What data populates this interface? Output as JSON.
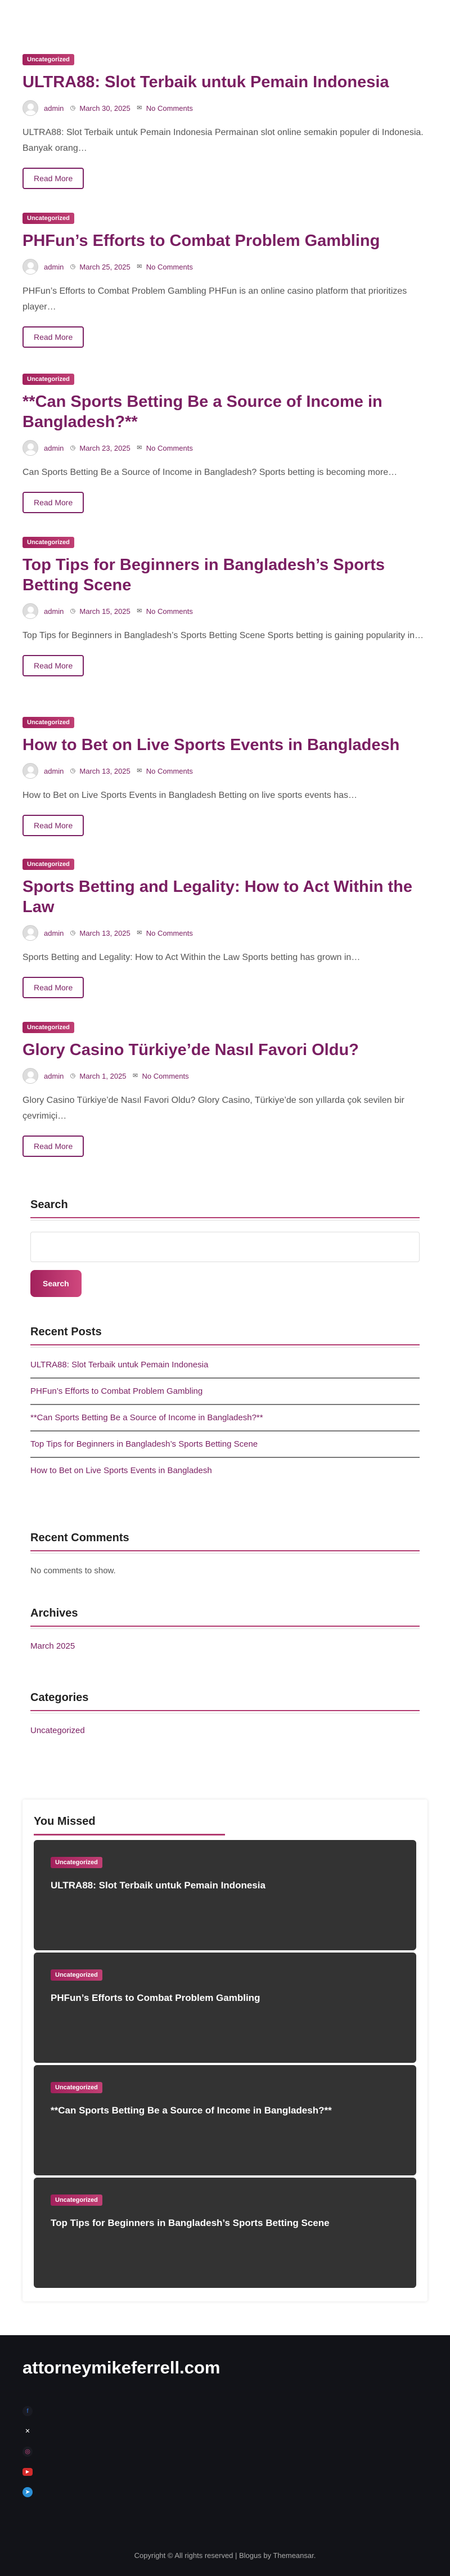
{
  "posts": [
    {
      "category": "Uncategorized",
      "title": "ULTRA88: Slot Terbaik untuk Pemain Indonesia",
      "author": "admin",
      "date": "March 30, 2025",
      "comments": "No Comments",
      "excerpt": "ULTRA88: Slot Terbaik untuk Pemain Indonesia Permainan slot online semakin populer di Indonesia. Banyak orang…",
      "read_more": "Read More"
    },
    {
      "category": "Uncategorized",
      "title": "PHFun’s Efforts to Combat Problem Gambling",
      "author": "admin",
      "date": "March 25, 2025",
      "comments": "No Comments",
      "excerpt": "PHFun’s Efforts to Combat Problem Gambling PHFun is an online casino platform that prioritizes player…",
      "read_more": "Read More"
    },
    {
      "category": "Uncategorized",
      "title": "**Can Sports Betting Be a Source of Income in Bangladesh?**",
      "author": "admin",
      "date": "March 23, 2025",
      "comments": "No Comments",
      "excerpt": "Can Sports Betting Be a Source of Income in Bangladesh? Sports betting is becoming more…",
      "read_more": "Read More"
    },
    {
      "category": "Uncategorized",
      "title": "Top Tips for Beginners in Bangladesh’s Sports Betting Scene",
      "author": "admin",
      "date": "March 15, 2025",
      "comments": "No Comments",
      "excerpt": "Top Tips for Beginners in Bangladesh’s Sports Betting Scene Sports betting is gaining popularity in…",
      "read_more": "Read More"
    },
    {
      "category": "Uncategorized",
      "title": "How to Bet on Live Sports Events in Bangladesh",
      "author": "admin",
      "date": "March 13, 2025",
      "comments": "No Comments",
      "excerpt": "How to Bet on Live Sports Events in Bangladesh Betting on live sports events has…",
      "read_more": "Read More"
    },
    {
      "category": "Uncategorized",
      "title": "Sports Betting and Legality: How to Act Within the Law",
      "author": "admin",
      "date": "March 13, 2025",
      "comments": "No Comments",
      "excerpt": "Sports Betting and Legality: How to Act Within the Law Sports betting has grown in…",
      "read_more": "Read More"
    },
    {
      "category": "Uncategorized",
      "title": "Glory Casino Türkiye’de Nasıl Favori Oldu?",
      "author": "admin",
      "date": "March 1, 2025",
      "comments": "No Comments",
      "excerpt": "Glory Casino Türkiye’de Nasıl Favori Oldu? Glory Casino, Türkiye’de son yıllarda çok sevilen bir çevrimiçi…",
      "read_more": "Read More"
    }
  ],
  "search": {
    "title": "Search",
    "placeholder": "",
    "button": "Search"
  },
  "recent_posts": {
    "title": "Recent Posts",
    "items": [
      "ULTRA88: Slot Terbaik untuk Pemain Indonesia",
      "PHFun’s Efforts to Combat Problem Gambling",
      "**Can Sports Betting Be a Source of Income in Bangladesh?**",
      "Top Tips for Beginners in Bangladesh’s Sports Betting Scene",
      "How to Bet on Live Sports Events in Bangladesh"
    ]
  },
  "recent_comments": {
    "title": "Recent Comments",
    "text": "No comments to show."
  },
  "archives": {
    "title": "Archives",
    "items": [
      "March 2025"
    ]
  },
  "categories": {
    "title": "Categories",
    "items": [
      "Uncategorized"
    ]
  },
  "you_missed": {
    "title": "You Missed",
    "cards": [
      {
        "category": "Uncategorized",
        "title": "ULTRA88: Slot Terbaik untuk Pemain Indonesia"
      },
      {
        "category": "Uncategorized",
        "title": "PHFun’s Efforts to Combat Problem Gambling"
      },
      {
        "category": "Uncategorized",
        "title": "**Can Sports Betting Be a Source of Income in Bangladesh?**"
      },
      {
        "category": "Uncategorized",
        "title": "Top Tips for Beginners in Bangladesh’s Sports Betting Scene"
      }
    ]
  },
  "footer": {
    "site_title": "attorneymikeferrell.com",
    "social_icons": [
      "facebook-icon",
      "x-icon",
      "instagram-icon",
      "youtube-icon",
      "telegram-icon"
    ],
    "copyright": "Copyright © All rights reserved | Blogus by Themeansar."
  },
  "colors": {
    "accent": "#7a1f62",
    "badge": "#a2215c",
    "footer_bg": "#121318",
    "card_bg": "#333333"
  }
}
